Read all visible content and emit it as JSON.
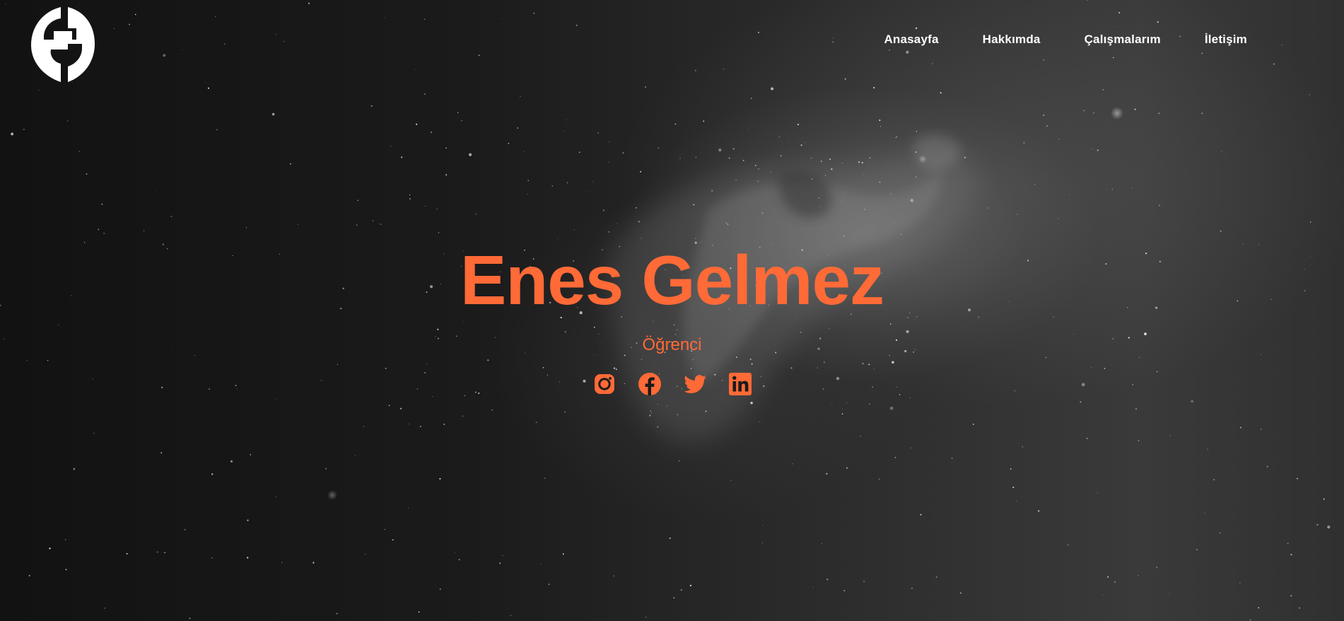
{
  "brand": {
    "logo_icon": "eg-monogram-logo"
  },
  "nav": {
    "items": [
      {
        "label": "Anasayfa"
      },
      {
        "label": "Hakkımda"
      },
      {
        "label": "Çalışmalarım"
      },
      {
        "label": "İletişim"
      }
    ]
  },
  "hero": {
    "name": "Enes Gelmez",
    "role": "Öğrenci"
  },
  "socials": [
    {
      "icon": "instagram-icon"
    },
    {
      "icon": "facebook-icon"
    },
    {
      "icon": "twitter-icon"
    },
    {
      "icon": "linkedin-icon"
    }
  ],
  "colors": {
    "accent": "#ff6a37",
    "nav_text": "#ffffff",
    "background": "#1b1b1b"
  }
}
